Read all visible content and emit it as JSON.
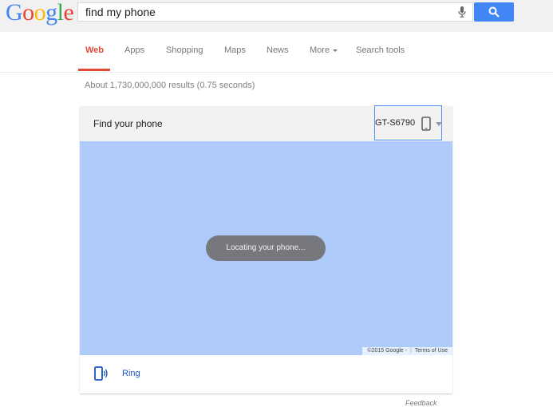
{
  "logo": {
    "letters": [
      "G",
      "o",
      "o",
      "g",
      "l",
      "e"
    ]
  },
  "search": {
    "query": "find my phone"
  },
  "tabs": [
    {
      "label": "Web",
      "active": true
    },
    {
      "label": "Apps"
    },
    {
      "label": "Shopping"
    },
    {
      "label": "Maps"
    },
    {
      "label": "News"
    },
    {
      "label": "More"
    },
    {
      "label": "Search tools"
    }
  ],
  "stats": "About 1,730,000,000 results (0.75 seconds)",
  "card": {
    "title": "Find your phone",
    "device": "GT-S6790",
    "status": "Locating your phone...",
    "map_copyright": "©2015 Google -",
    "map_terms": "Terms of Use",
    "action_label": "Ring"
  },
  "feedback": "Feedback",
  "colors": {
    "accent": "#4285f4",
    "active_tab": "#dd4b39",
    "map": "#aecbfa",
    "link": "#1a55c2"
  }
}
